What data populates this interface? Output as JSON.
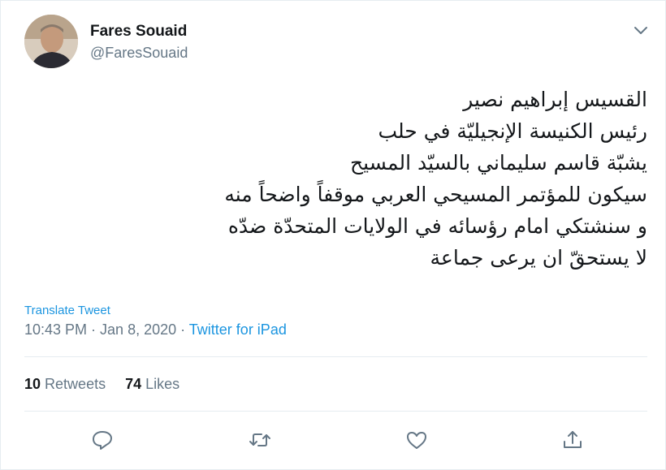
{
  "author": {
    "name": "Fares Souaid",
    "handle": "@FaresSouaid"
  },
  "tweet": {
    "lines": [
      "القسيس إبراهيم نصير",
      "رئيس الكنيسة الإنجيليّة في حلب",
      "يشبّة قاسم سليماني بالسيّد المسيح",
      "سيكون للمؤتمر المسيحي العربي موقفاً واضحاً منه",
      "و سنشتكي امام رؤسائه في الولايات المتحدّة ضدّه",
      "لا يستحقّ ان يرعى جماعة"
    ],
    "translate_label": "Translate Tweet",
    "time": "10:43 PM",
    "dot": " · ",
    "date": "Jan 8, 2020",
    "source": "Twitter for iPad"
  },
  "stats": {
    "retweets_count": "10",
    "retweets_label": "Retweets",
    "likes_count": "74",
    "likes_label": "Likes"
  },
  "icons": {
    "menu": "chevron-down-icon",
    "reply": "reply-icon",
    "retweet": "retweet-icon",
    "like": "heart-icon",
    "share": "share-icon"
  },
  "colors": {
    "link": "#1b95e0",
    "secondary": "#657786",
    "text": "#14171a",
    "divider": "#e6ecf0"
  }
}
